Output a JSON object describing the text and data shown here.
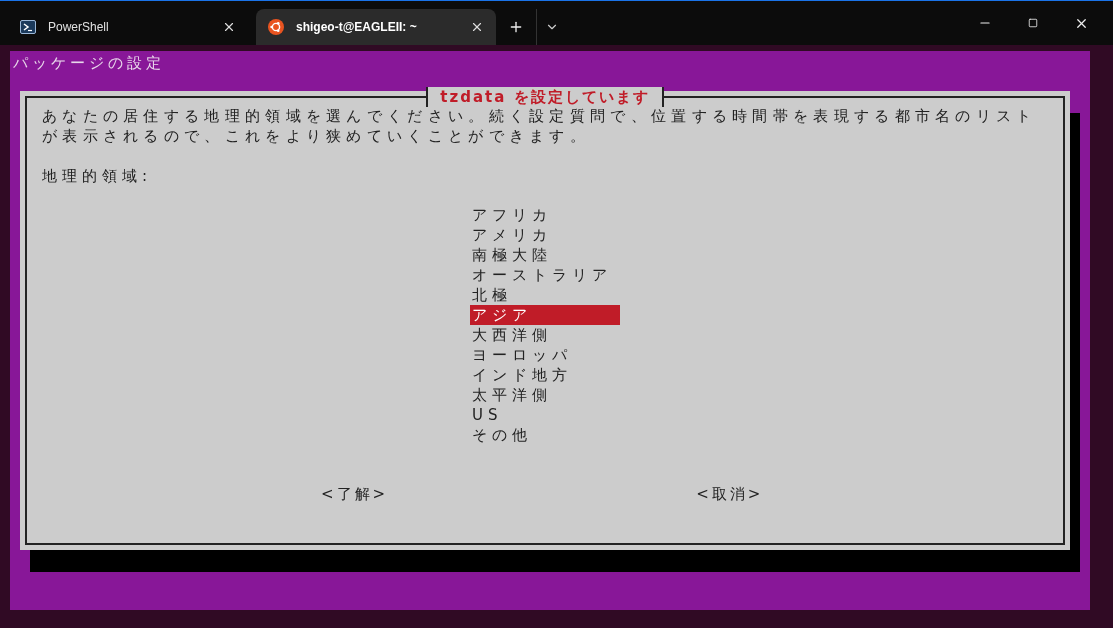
{
  "tabs": [
    {
      "label": "PowerShell",
      "kind": "powershell",
      "selected": false
    },
    {
      "label": "shigeo-t@EAGLEII: ~",
      "kind": "ubuntu",
      "selected": true
    }
  ],
  "backtitle": "パッケージの設定",
  "dialog": {
    "title": "tzdata を設定しています",
    "description": "あなたの居住する地理的領域を選んでください。続く設定質問で、位置する時間帯を表現する都市名のリストが表示されるので、これをより狭めていくことができます。",
    "label": "地理的領域:",
    "options": [
      {
        "label": "アフリカ",
        "selected": false
      },
      {
        "label": "アメリカ",
        "selected": false
      },
      {
        "label": "南極大陸",
        "selected": false
      },
      {
        "label": "オーストラリア",
        "selected": false
      },
      {
        "label": "北極",
        "selected": false
      },
      {
        "label": "アジア",
        "selected": true
      },
      {
        "label": "大西洋側",
        "selected": false
      },
      {
        "label": "ヨーロッパ",
        "selected": false
      },
      {
        "label": "インド地方",
        "selected": false
      },
      {
        "label": "太平洋側",
        "selected": false
      },
      {
        "label": "US",
        "selected": false
      },
      {
        "label": "その他",
        "selected": false
      }
    ],
    "buttons": [
      "<了解>",
      "<取消>"
    ]
  }
}
